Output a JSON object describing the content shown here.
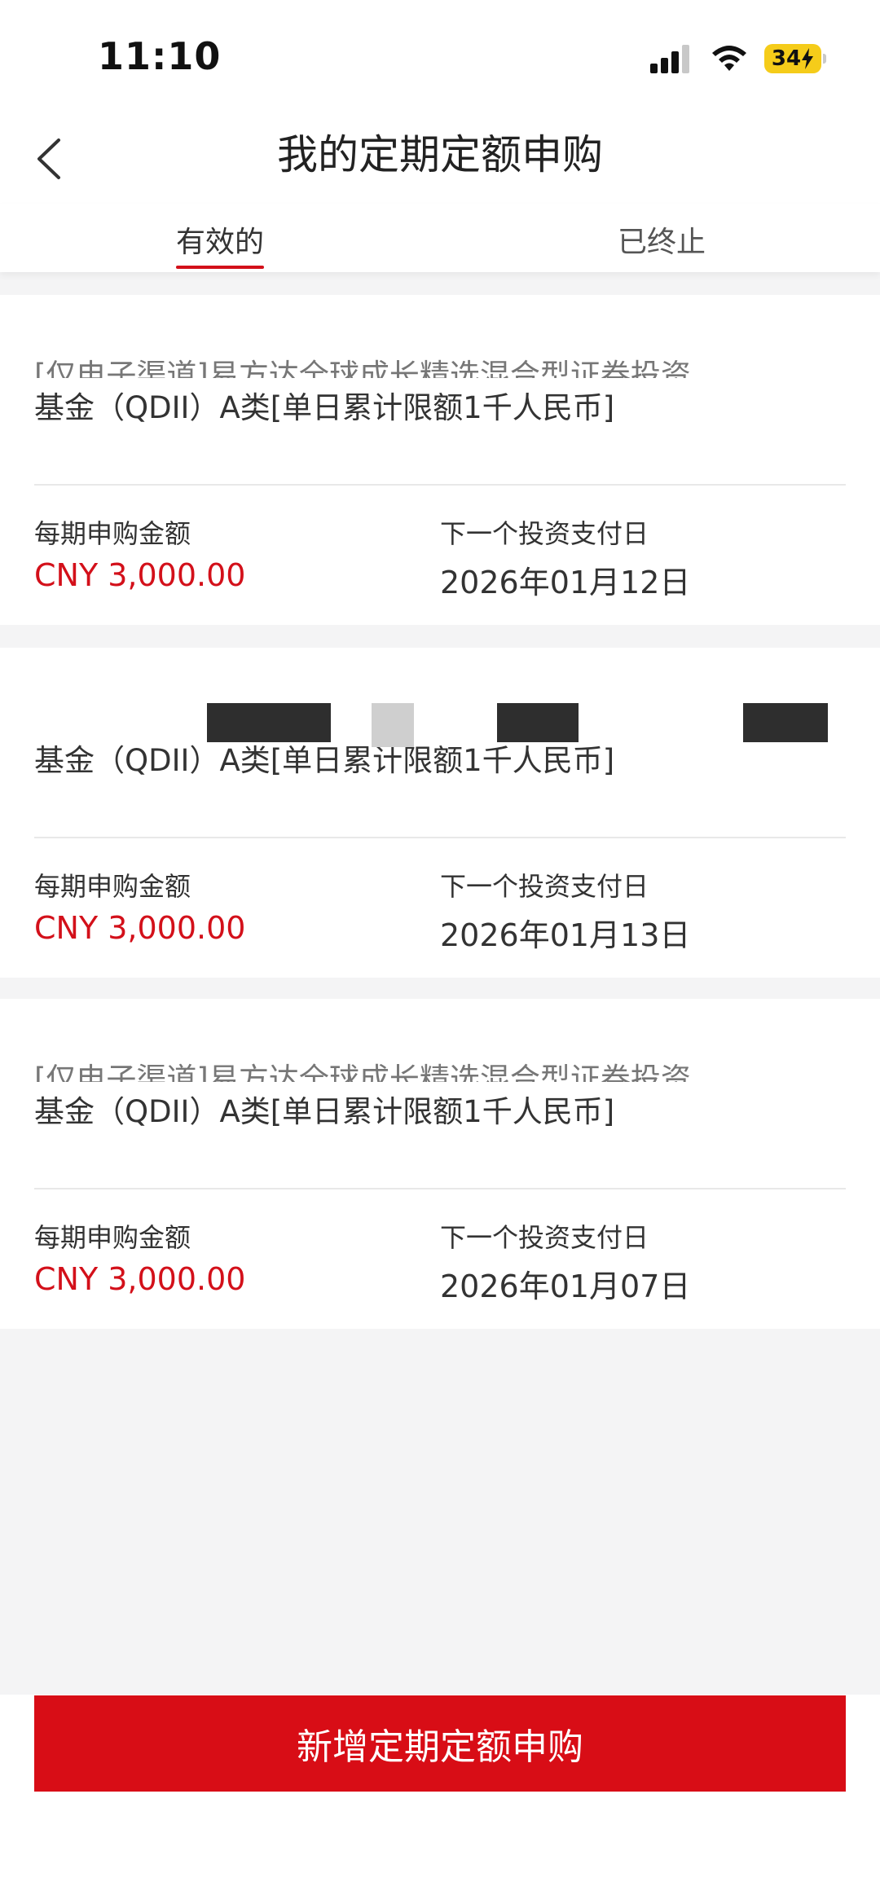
{
  "status_bar": {
    "time": "11:10",
    "battery": "34"
  },
  "nav": {
    "title": "我的定期定额申购",
    "back_icon": "chevron-left-icon"
  },
  "tabs": [
    {
      "label": "有效的",
      "active": true
    },
    {
      "label": "已终止",
      "active": false
    }
  ],
  "plans": [
    {
      "fund_name_line1": "[仅电子渠道]易方达全球成长精选混合型证券投资",
      "fund_name_line2": "基金（QDII）A类[单日累计限额1千人民币]",
      "amount_label": "每期申购金额",
      "amount": "CNY 3,000.00",
      "date_label": "下一个投资支付日",
      "next_date": "2026年01月12日"
    },
    {
      "fund_name_line1": "",
      "fund_name_line2": "基金（QDII）A类[单日累计限额1千人民币]",
      "amount_label": "每期申购金额",
      "amount": "CNY 3,000.00",
      "date_label": "下一个投资支付日",
      "next_date": "2026年01月13日"
    },
    {
      "fund_name_line1": "[仅电子渠道]易方达全球成长精选混合型证券投资",
      "fund_name_line2": "基金（QDII）A类[单日累计限额1千人民币]",
      "amount_label": "每期申购金额",
      "amount": "CNY 3,000.00",
      "date_label": "下一个投资支付日",
      "next_date": "2026年01月07日"
    }
  ],
  "actions": {
    "add_label": "新增定期定额申购"
  },
  "colors": {
    "accent": "#d3101a",
    "button": "#d80d16",
    "background": "#f4f4f5"
  }
}
